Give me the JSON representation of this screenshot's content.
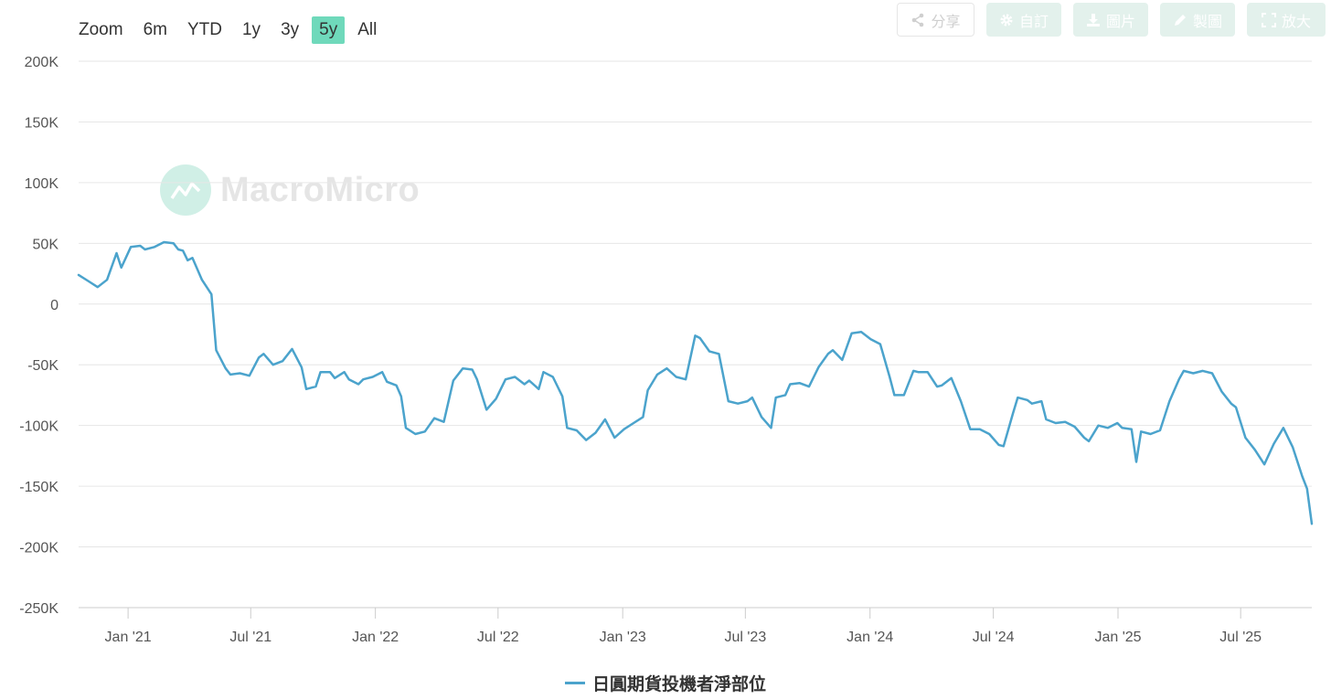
{
  "zoom": {
    "label": "Zoom",
    "ranges": [
      "6m",
      "YTD",
      "1y",
      "3y",
      "5y",
      "All"
    ],
    "active": "5y"
  },
  "toolbar": {
    "share": "分享",
    "custom": "自訂",
    "image": "圖片",
    "draw": "製圖",
    "expand": "放大"
  },
  "watermark": {
    "text": "MacroMicro"
  },
  "colors": {
    "series": "#4ba3cc",
    "active_range": "#6fd9bb",
    "grid": "#e6e6e6"
  },
  "chart_data": {
    "type": "line",
    "title": "",
    "xlabel": "",
    "ylabel": "",
    "ylim": [
      -250000,
      200000
    ],
    "yticks": [
      200000,
      150000,
      100000,
      50000,
      0,
      -50000,
      -100000,
      -150000,
      -200000,
      -250000
    ],
    "ytick_labels": [
      "200K",
      "150K",
      "100K",
      "50K",
      "0",
      "-50K",
      "-100K",
      "-150K",
      "-200K",
      "-250K"
    ],
    "xlim": [
      "2020-10-20",
      "2025-10-14"
    ],
    "xticks": [
      "2021-01-01",
      "2021-07-01",
      "2022-01-01",
      "2022-07-01",
      "2023-01-01",
      "2023-07-01",
      "2024-01-01",
      "2024-07-01",
      "2025-01-01",
      "2025-07-01"
    ],
    "xtick_labels": [
      "Jan '21",
      "Jul '21",
      "Jan '22",
      "Jul '22",
      "Jan '23",
      "Jul '23",
      "Jan '24",
      "Jul '24",
      "Jan '25",
      "Jul '25"
    ],
    "grid": true,
    "legend_position": "bottom-center",
    "series": [
      {
        "name": "日圓期貨投機者淨部位",
        "color": "#4ba3cc",
        "points": [
          [
            "2020-10-20",
            24000
          ],
          [
            "2020-11-03",
            19000
          ],
          [
            "2020-11-17",
            14000
          ],
          [
            "2020-12-01",
            20000
          ],
          [
            "2020-12-15",
            42000
          ],
          [
            "2020-12-22",
            30000
          ],
          [
            "2021-01-05",
            47000
          ],
          [
            "2021-01-19",
            48000
          ],
          [
            "2021-01-26",
            45000
          ],
          [
            "2021-02-09",
            47000
          ],
          [
            "2021-02-23",
            51000
          ],
          [
            "2021-03-09",
            50000
          ],
          [
            "2021-03-16",
            45000
          ],
          [
            "2021-03-23",
            44000
          ],
          [
            "2021-03-30",
            36000
          ],
          [
            "2021-04-06",
            38000
          ],
          [
            "2021-04-20",
            20000
          ],
          [
            "2021-05-04",
            8000
          ],
          [
            "2021-05-11",
            -38000
          ],
          [
            "2021-05-25",
            -53000
          ],
          [
            "2021-06-01",
            -58000
          ],
          [
            "2021-06-15",
            -57000
          ],
          [
            "2021-06-29",
            -59000
          ],
          [
            "2021-07-13",
            -44000
          ],
          [
            "2021-07-20",
            -41000
          ],
          [
            "2021-08-03",
            -50000
          ],
          [
            "2021-08-17",
            -47000
          ],
          [
            "2021-08-31",
            -37000
          ],
          [
            "2021-09-14",
            -52000
          ],
          [
            "2021-09-21",
            -70000
          ],
          [
            "2021-10-05",
            -68000
          ],
          [
            "2021-10-12",
            -56000
          ],
          [
            "2021-10-26",
            -56000
          ],
          [
            "2021-11-02",
            -61000
          ],
          [
            "2021-11-16",
            -56000
          ],
          [
            "2021-11-23",
            -62000
          ],
          [
            "2021-12-07",
            -66000
          ],
          [
            "2021-12-14",
            -62000
          ],
          [
            "2021-12-28",
            -60000
          ],
          [
            "2022-01-11",
            -56000
          ],
          [
            "2022-01-18",
            -64000
          ],
          [
            "2022-02-01",
            -67000
          ],
          [
            "2022-02-08",
            -76000
          ],
          [
            "2022-02-15",
            -102000
          ],
          [
            "2022-03-01",
            -107000
          ],
          [
            "2022-03-15",
            -105000
          ],
          [
            "2022-03-29",
            -94000
          ],
          [
            "2022-04-12",
            -97000
          ],
          [
            "2022-04-26",
            -63000
          ],
          [
            "2022-05-10",
            -53000
          ],
          [
            "2022-05-24",
            -54000
          ],
          [
            "2022-05-31",
            -62000
          ],
          [
            "2022-06-14",
            -87000
          ],
          [
            "2022-06-28",
            -78000
          ],
          [
            "2022-07-12",
            -62000
          ],
          [
            "2022-07-26",
            -60000
          ],
          [
            "2022-08-09",
            -66000
          ],
          [
            "2022-08-16",
            -63000
          ],
          [
            "2022-08-30",
            -70000
          ],
          [
            "2022-09-06",
            -56000
          ],
          [
            "2022-09-20",
            -60000
          ],
          [
            "2022-10-04",
            -76000
          ],
          [
            "2022-10-11",
            -102000
          ],
          [
            "2022-10-25",
            -104000
          ],
          [
            "2022-11-08",
            -112000
          ],
          [
            "2022-11-22",
            -106000
          ],
          [
            "2022-12-06",
            -95000
          ],
          [
            "2022-12-20",
            -110000
          ],
          [
            "2023-01-03",
            -103000
          ],
          [
            "2023-01-17",
            -98000
          ],
          [
            "2023-01-31",
            -93000
          ],
          [
            "2023-02-07",
            -71000
          ],
          [
            "2023-02-21",
            -58000
          ],
          [
            "2023-03-07",
            -53000
          ],
          [
            "2023-03-21",
            -60000
          ],
          [
            "2023-04-04",
            -62000
          ],
          [
            "2023-04-18",
            -26000
          ],
          [
            "2023-04-25",
            -28000
          ],
          [
            "2023-05-09",
            -39000
          ],
          [
            "2023-05-23",
            -41000
          ],
          [
            "2023-06-06",
            -80000
          ],
          [
            "2023-06-20",
            -82000
          ],
          [
            "2023-07-04",
            -80000
          ],
          [
            "2023-07-11",
            -77000
          ],
          [
            "2023-07-25",
            -93000
          ],
          [
            "2023-08-08",
            -102000
          ],
          [
            "2023-08-15",
            -77000
          ],
          [
            "2023-08-29",
            -75000
          ],
          [
            "2023-09-05",
            -66000
          ],
          [
            "2023-09-19",
            -65000
          ],
          [
            "2023-10-03",
            -68000
          ],
          [
            "2023-10-17",
            -52000
          ],
          [
            "2023-10-31",
            -41000
          ],
          [
            "2023-11-07",
            -38000
          ],
          [
            "2023-11-21",
            -46000
          ],
          [
            "2023-12-05",
            -24000
          ],
          [
            "2023-12-19",
            -23000
          ],
          [
            "2024-01-02",
            -29000
          ],
          [
            "2024-01-16",
            -33000
          ],
          [
            "2024-01-30",
            -60000
          ],
          [
            "2024-02-06",
            -75000
          ],
          [
            "2024-02-20",
            -75000
          ],
          [
            "2024-03-05",
            -55000
          ],
          [
            "2024-03-12",
            -56000
          ],
          [
            "2024-03-26",
            -56000
          ],
          [
            "2024-04-09",
            -68000
          ],
          [
            "2024-04-16",
            -67000
          ],
          [
            "2024-04-30",
            -61000
          ],
          [
            "2024-05-14",
            -80000
          ],
          [
            "2024-05-28",
            -103000
          ],
          [
            "2024-06-11",
            -103000
          ],
          [
            "2024-06-25",
            -107000
          ],
          [
            "2024-07-09",
            -116000
          ],
          [
            "2024-07-16",
            -117000
          ],
          [
            "2024-07-30",
            -90000
          ],
          [
            "2024-08-06",
            -77000
          ],
          [
            "2024-08-20",
            -79000
          ],
          [
            "2024-08-27",
            -82000
          ],
          [
            "2024-09-10",
            -80000
          ],
          [
            "2024-09-17",
            -95000
          ],
          [
            "2024-10-01",
            -98000
          ],
          [
            "2024-10-15",
            -97000
          ],
          [
            "2024-10-29",
            -101000
          ],
          [
            "2024-11-12",
            -110000
          ],
          [
            "2024-11-19",
            -113000
          ],
          [
            "2024-12-03",
            -100000
          ],
          [
            "2024-12-17",
            -102000
          ],
          [
            "2024-12-31",
            -98000
          ],
          [
            "2025-01-07",
            -102000
          ],
          [
            "2025-01-21",
            -103000
          ],
          [
            "2025-01-28",
            -130000
          ],
          [
            "2025-02-04",
            -105000
          ],
          [
            "2025-02-18",
            -107000
          ],
          [
            "2025-03-04",
            -104000
          ],
          [
            "2025-03-18",
            -80000
          ],
          [
            "2025-04-01",
            -62000
          ],
          [
            "2025-04-08",
            -55000
          ],
          [
            "2025-04-22",
            -57000
          ],
          [
            "2025-05-06",
            -55000
          ],
          [
            "2025-05-20",
            -57000
          ],
          [
            "2025-06-03",
            -72000
          ],
          [
            "2025-06-17",
            -82000
          ],
          [
            "2025-06-24",
            -85000
          ],
          [
            "2025-07-08",
            -110000
          ],
          [
            "2025-07-22",
            -120000
          ],
          [
            "2025-08-05",
            -132000
          ],
          [
            "2025-08-19",
            -115000
          ],
          [
            "2025-09-02",
            -102000
          ],
          [
            "2025-09-16",
            -118000
          ],
          [
            "2025-09-30",
            -142000
          ],
          [
            "2025-10-07",
            -152000
          ],
          [
            "2025-10-14",
            -181000
          ]
        ]
      }
    ]
  },
  "legend": {
    "label": "日圓期貨投機者淨部位"
  }
}
